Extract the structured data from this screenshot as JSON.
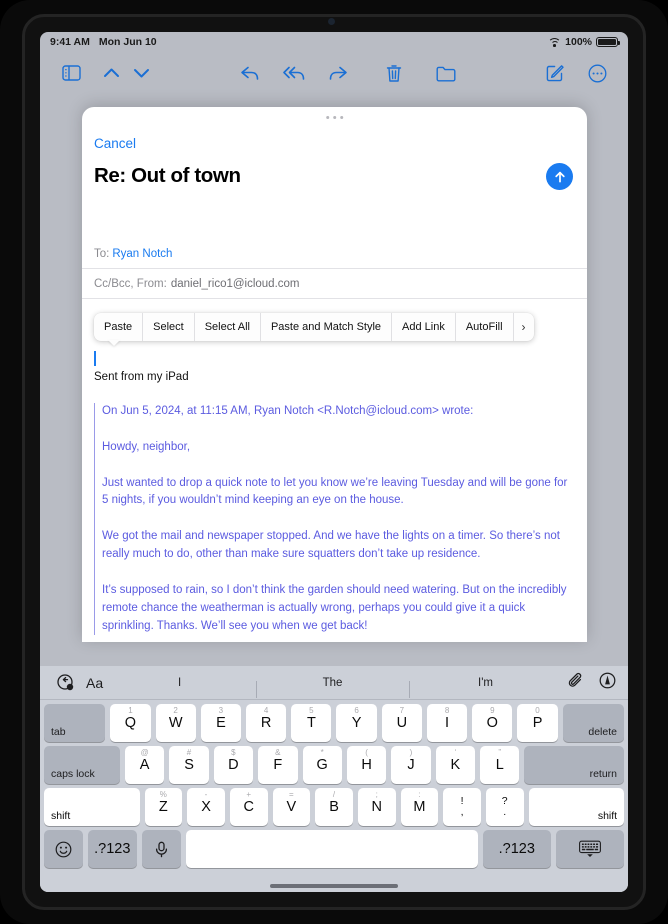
{
  "status_bar": {
    "time": "9:41 AM",
    "date": "Mon Jun 10",
    "battery_percent": "100%",
    "wifi_icon": "wifi-icon",
    "battery_icon": "battery-icon"
  },
  "toolbar": {
    "items": [
      {
        "name": "sidebar-toggle-icon",
        "label": "Sidebar"
      },
      {
        "name": "chevron-up-icon",
        "label": "Previous Message"
      },
      {
        "name": "chevron-down-icon",
        "label": "Next Message"
      },
      {
        "name": "reply-icon",
        "label": "Reply"
      },
      {
        "name": "reply-all-icon",
        "label": "Reply All"
      },
      {
        "name": "forward-icon",
        "label": "Forward"
      },
      {
        "name": "trash-icon",
        "label": "Delete"
      },
      {
        "name": "folder-icon",
        "label": "Move to Folder"
      },
      {
        "name": "compose-icon",
        "label": "New Message"
      },
      {
        "name": "more-icon",
        "label": "More"
      }
    ]
  },
  "compose": {
    "cancel_label": "Cancel",
    "subject": "Re: Out of town",
    "send_icon": "send-arrow-up-icon",
    "to": {
      "label": "To:",
      "value": "Ryan Notch"
    },
    "cc": {
      "label": "Cc/Bcc, From:",
      "value": "daniel_rico1@icloud.com"
    },
    "signature": "Sent from my iPad",
    "quote": [
      "On Jun 5, 2024, at 11:15 AM, Ryan Notch <R.Notch@icloud.com> wrote:",
      "Howdy, neighbor,",
      "Just wanted to drop a quick note to let you know we’re leaving Tuesday and will be gone for 5 nights, if you wouldn’t mind keeping an eye on the house.",
      "We got the mail and newspaper stopped. And we have the lights on a timer. So there’s not really much to do, other than make sure squatters don’t take up residence.",
      "It’s supposed to rain, so I don’t think the garden should need watering. But on the incredibly remote chance the weatherman is actually wrong, perhaps you could give it a quick sprinkling. Thanks. We’ll see you when we get back!"
    ]
  },
  "edit_menu": {
    "items": [
      "Paste",
      "Select",
      "Select All",
      "Paste and Match Style",
      "Add Link",
      "AutoFill"
    ],
    "more_chevron": "›"
  },
  "keyboard": {
    "predictive": {
      "undo_icon": "undo-icon",
      "format_label": "Aa",
      "suggestions": [
        "I",
        "The",
        "I'm"
      ],
      "attach_icon": "paperclip-icon",
      "markup_icon": "markup-pen-icon"
    },
    "row1": {
      "tab": "tab",
      "keys": [
        {
          "alt": "1",
          "main": "Q"
        },
        {
          "alt": "2",
          "main": "W"
        },
        {
          "alt": "3",
          "main": "E"
        },
        {
          "alt": "4",
          "main": "R"
        },
        {
          "alt": "5",
          "main": "T"
        },
        {
          "alt": "6",
          "main": "Y"
        },
        {
          "alt": "7",
          "main": "U"
        },
        {
          "alt": "8",
          "main": "I"
        },
        {
          "alt": "9",
          "main": "O"
        },
        {
          "alt": "0",
          "main": "P"
        }
      ],
      "delete": "delete"
    },
    "row2": {
      "caps": "caps lock",
      "keys": [
        {
          "alt": "@",
          "main": "A"
        },
        {
          "alt": "#",
          "main": "S"
        },
        {
          "alt": "$",
          "main": "D"
        },
        {
          "alt": "&",
          "main": "F"
        },
        {
          "alt": "*",
          "main": "G"
        },
        {
          "alt": "(",
          "main": "H"
        },
        {
          "alt": ")",
          "main": "J"
        },
        {
          "alt": "‘",
          "main": "K"
        },
        {
          "alt": "”",
          "main": "L"
        }
      ],
      "return": "return"
    },
    "row3": {
      "shift_left": "shift",
      "keys": [
        {
          "alt": "%",
          "main": "Z"
        },
        {
          "alt": "-",
          "main": "X"
        },
        {
          "alt": "+",
          "main": "C"
        },
        {
          "alt": "=",
          "main": "V"
        },
        {
          "alt": "/",
          "main": "B"
        },
        {
          "alt": ";",
          "main": "N"
        },
        {
          "alt": ":",
          "main": "M"
        }
      ],
      "dual_keys": [
        {
          "top": "!",
          "bot": ","
        },
        {
          "top": "?",
          "bot": "."
        }
      ],
      "shift_right": "shift"
    },
    "row4": {
      "emoji_icon": "emoji-icon",
      "numeric_left": ".?123",
      "mic_icon": "microphone-icon",
      "space": "",
      "numeric_right": ".?123",
      "dismiss_icon": "hide-keyboard-icon"
    }
  }
}
